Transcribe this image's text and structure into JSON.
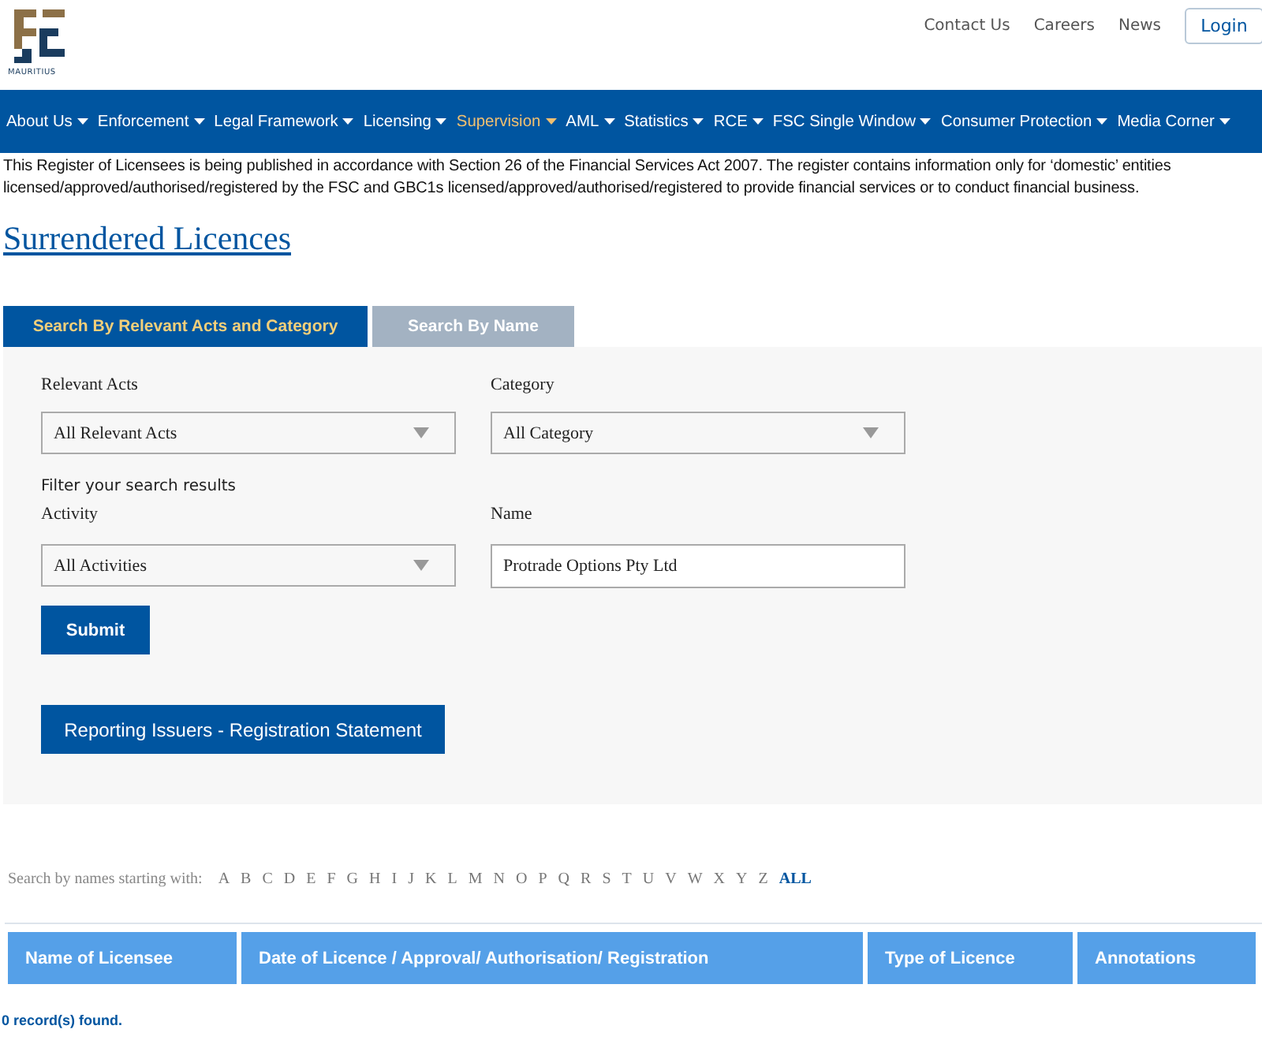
{
  "logo": {
    "caption": "MAURITIUS"
  },
  "top_links": [
    "Contact Us",
    "Careers",
    "News"
  ],
  "login": "Login",
  "nav": [
    {
      "label": "About Us",
      "selected": false
    },
    {
      "label": "Enforcement",
      "selected": false
    },
    {
      "label": "Legal Framework",
      "selected": false
    },
    {
      "label": "Licensing",
      "selected": false
    },
    {
      "label": "Supervision",
      "selected": true
    },
    {
      "label": "AML",
      "selected": false
    },
    {
      "label": "Statistics",
      "selected": false
    },
    {
      "label": "RCE",
      "selected": false
    },
    {
      "label": "FSC Single Window",
      "selected": false
    },
    {
      "label": "Consumer Protection",
      "selected": false
    },
    {
      "label": "Media Corner",
      "selected": false
    }
  ],
  "intro": "This Register of Licensees is being published in accordance with Section 26 of the Financial Services Act 2007. The register contains information only for ‘domestic’ entities licensed/approved/authorised/registered by the FSC and GBC1s licensed/approved/authorised/registered to provide financial services or to conduct financial business.",
  "title": "Surrendered Licences",
  "tabs": [
    {
      "label": "Search By Relevant Acts and Category",
      "selected": true
    },
    {
      "label": "Search By Name",
      "selected": false
    }
  ],
  "form": {
    "relevant_acts": {
      "label": "Relevant Acts",
      "value": "All Relevant Acts"
    },
    "category": {
      "label": "Category",
      "value": "All Category"
    },
    "filter_note": "Filter your search results",
    "activity": {
      "label": "Activity",
      "value": "All Activities"
    },
    "name": {
      "label": "Name",
      "value": "Protrade Options Pty Ltd"
    },
    "submit": "Submit",
    "reporting_button": "Reporting Issuers - Registration Statement"
  },
  "alphabet": {
    "label": "Search by names starting with:",
    "letters": [
      {
        "label": "A",
        "selected": false
      },
      {
        "label": "B",
        "selected": false
      },
      {
        "label": "C",
        "selected": false
      },
      {
        "label": "D",
        "selected": false
      },
      {
        "label": "E",
        "selected": false
      },
      {
        "label": "F",
        "selected": false
      },
      {
        "label": "G",
        "selected": false
      },
      {
        "label": "H",
        "selected": false
      },
      {
        "label": "I",
        "selected": false
      },
      {
        "label": "J",
        "selected": false
      },
      {
        "label": "K",
        "selected": false
      },
      {
        "label": "L",
        "selected": false
      },
      {
        "label": "M",
        "selected": false
      },
      {
        "label": "N",
        "selected": false
      },
      {
        "label": "O",
        "selected": false
      },
      {
        "label": "P",
        "selected": false
      },
      {
        "label": "Q",
        "selected": false
      },
      {
        "label": "R",
        "selected": false
      },
      {
        "label": "S",
        "selected": false
      },
      {
        "label": "T",
        "selected": false
      },
      {
        "label": "U",
        "selected": false
      },
      {
        "label": "V",
        "selected": false
      },
      {
        "label": "W",
        "selected": false
      },
      {
        "label": "X",
        "selected": false
      },
      {
        "label": "Y",
        "selected": false
      },
      {
        "label": "Z",
        "selected": false
      },
      {
        "label": "ALL",
        "selected": true
      }
    ]
  },
  "table": {
    "columns": [
      "Name of Licensee",
      "Date of Licence / Approval/ Authorisation/ Registration",
      "Type of Licence",
      "Annotations"
    ]
  },
  "status": "0 record(s) found."
}
